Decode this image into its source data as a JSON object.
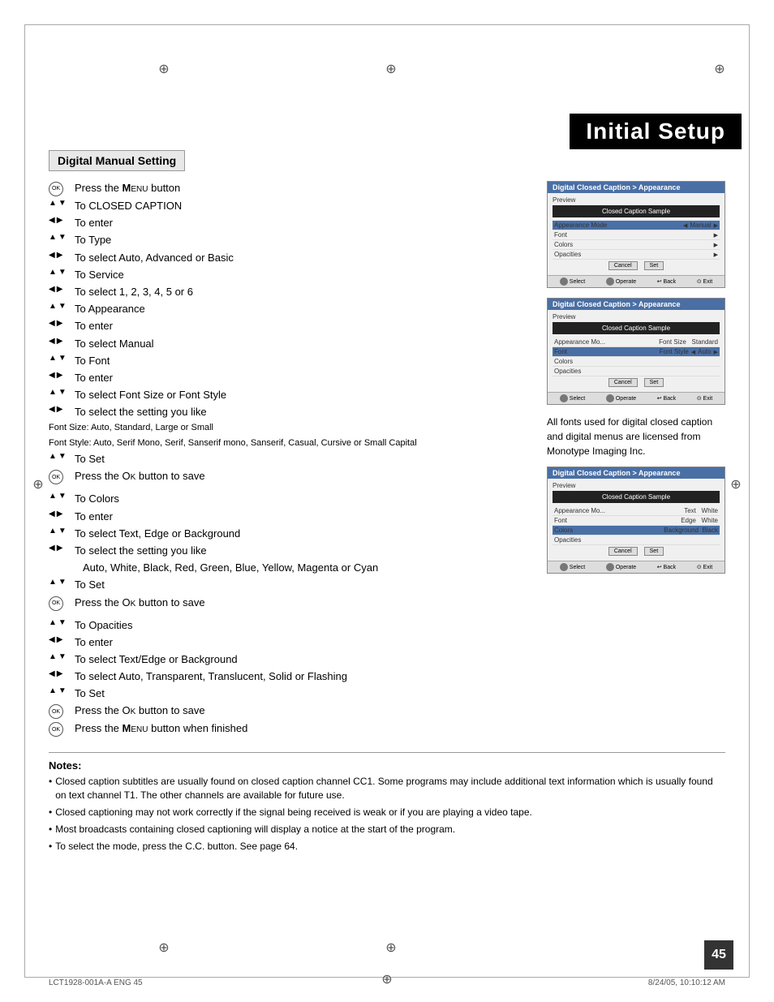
{
  "page": {
    "title": "Initial Setup",
    "page_number": "45",
    "footer_left": "LCT1928-001A-A ENG  45",
    "footer_right": "8/24/05, 10:10:12 AM"
  },
  "section": {
    "heading": "Digital Manual Setting"
  },
  "instructions": [
    {
      "type": "ok",
      "text": "Press the MENU button"
    },
    {
      "type": "updown",
      "text": "To CLOSED CAPTION"
    },
    {
      "type": "leftright",
      "text": "To enter"
    },
    {
      "type": "updown",
      "text": "To Type"
    },
    {
      "type": "leftright",
      "text": "To select Auto, Advanced or Basic"
    },
    {
      "type": "updown",
      "text": "To Service"
    },
    {
      "type": "leftright",
      "text": "To select 1, 2, 3, 4, 5 or 6"
    },
    {
      "type": "updown",
      "text": "To Appearance"
    },
    {
      "type": "leftright",
      "text": "To enter"
    },
    {
      "type": "leftright",
      "text": "To select Manual"
    },
    {
      "type": "updown",
      "text": "To Font"
    },
    {
      "type": "leftright",
      "text": "To enter"
    },
    {
      "type": "updown",
      "text": "To select Font Size or Font Style"
    },
    {
      "type": "leftright",
      "text": "To select the setting you like"
    }
  ],
  "font_notes": [
    "Font Size: Auto, Standard, Large or Small",
    "Font Style: Auto, Serif Mono, Serif, Sanserif mono, Sanserif, Casual, Cursive or Small Capital"
  ],
  "instructions2": [
    {
      "type": "updown",
      "text": "To Set"
    },
    {
      "type": "ok",
      "text": "Press the OK button to save"
    },
    {
      "type": "updown",
      "text": "To Colors"
    },
    {
      "type": "leftright",
      "text": "To enter"
    },
    {
      "type": "updown",
      "text": "To select Text, Edge or Background"
    },
    {
      "type": "leftright",
      "text": "To select the setting you like"
    }
  ],
  "color_options": "Auto, White, Black, Red, Green, Blue, Yellow, Magenta or Cyan",
  "instructions3": [
    {
      "type": "updown",
      "text": "To Set"
    },
    {
      "type": "ok",
      "text": "Press the OK button to save"
    },
    {
      "type": "updown",
      "text": "To Opacities"
    },
    {
      "type": "leftright",
      "text": "To enter"
    },
    {
      "type": "updown",
      "text": "To select Text/Edge or Background"
    },
    {
      "type": "leftright",
      "text": "To select Auto, Transparent, Translucent, Solid or Flashing"
    },
    {
      "type": "updown",
      "text": "To Set"
    },
    {
      "type": "ok",
      "text": "Press the OK button to save"
    },
    {
      "type": "ok",
      "text": "Press the MENU button when finished"
    }
  ],
  "side_note": "All fonts used for digital closed caption and digital menus are licensed from Monotype Imaging Inc.",
  "notes_title": "Notes:",
  "notes": [
    "Closed caption subtitles are usually found on closed caption channel CC1. Some programs may include additional text information which is usually found on text channel T1. The other channels are available for future use.",
    "Closed captioning may not work correctly if the signal being received is weak or if you are playing a video tape.",
    "Most broadcasts containing closed captioning will display a notice at the start of the program.",
    "To select the mode, press the C.C. button. See page 64."
  ],
  "screens": [
    {
      "header": "Digital Closed Caption > Appearance",
      "preview_label": "Preview",
      "preview_text": "Closed Caption Sample",
      "rows": [
        {
          "label": "Appearance Mode",
          "value": "Manual",
          "highlighted": true,
          "has_arrows": true
        },
        {
          "label": "Font",
          "value": "",
          "has_arrow_right": true
        },
        {
          "label": "Colors",
          "value": "",
          "has_arrow_right": true
        },
        {
          "label": "Opacities",
          "value": "",
          "has_arrow_right": true
        }
      ],
      "footer": [
        "Select",
        "Operate",
        "Back",
        "Exit"
      ]
    },
    {
      "header": "Digital Closed Caption > Appearance",
      "preview_label": "Preview",
      "preview_text": "Closed Caption Sample",
      "rows": [
        {
          "label": "Appearance Mo...",
          "value": "Font Size: Standard",
          "highlighted": false
        },
        {
          "label": "Font",
          "value": "Font Style: Auto",
          "highlighted": true,
          "has_arrows": true
        },
        {
          "label": "Colors",
          "value": "",
          "has_arrow_right": false
        },
        {
          "label": "Opacities",
          "value": "",
          "has_arrow_right": false
        }
      ],
      "footer": [
        "Select",
        "Operate",
        "Back",
        "Exit"
      ]
    },
    {
      "header": "Digital Closed Caption > Appearance",
      "preview_label": "Preview",
      "preview_text": "Closed Caption Sample",
      "rows": [
        {
          "label": "Appearance Mo...",
          "value": "Text: White",
          "highlighted": false
        },
        {
          "label": "Font",
          "value": "Edge: White",
          "highlighted": false
        },
        {
          "label": "Colors",
          "value": "Background: Black",
          "highlighted": true
        },
        {
          "label": "Opacities",
          "value": "",
          "has_arrow_right": false
        }
      ],
      "footer": [
        "Select",
        "Operate",
        "Back",
        "Exit"
      ]
    }
  ]
}
